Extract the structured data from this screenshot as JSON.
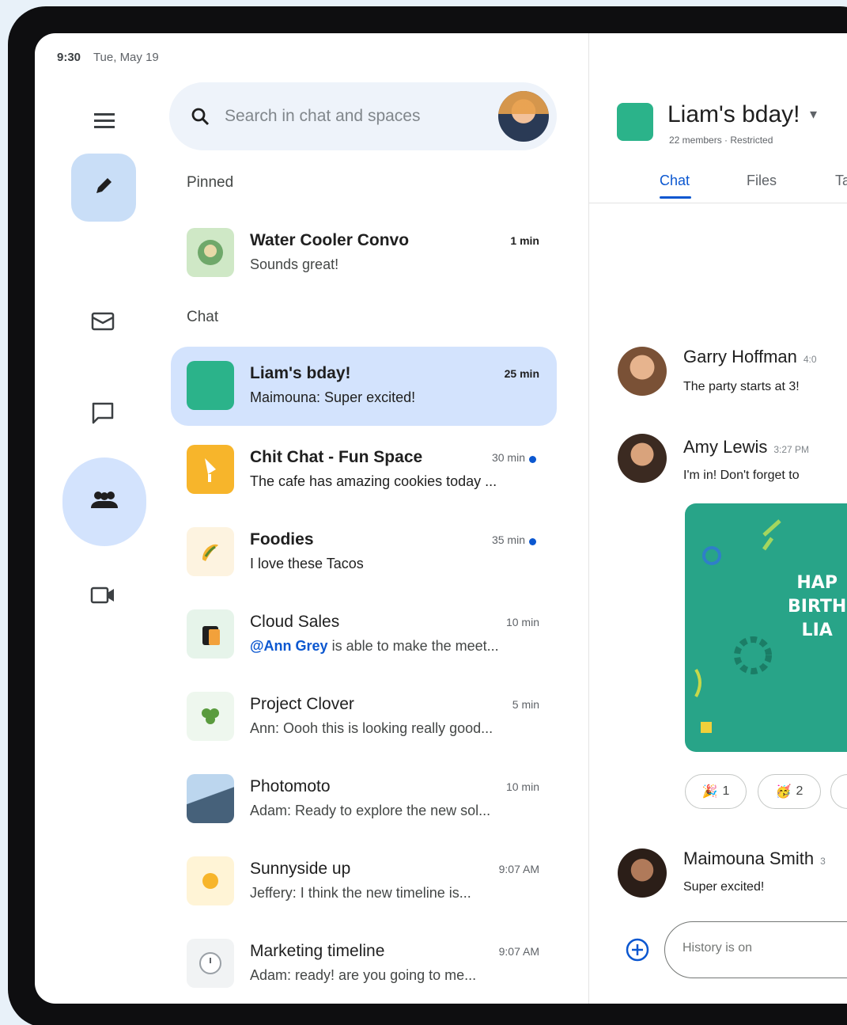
{
  "status_bar": {
    "time": "9:30",
    "date": "Tue, May 19"
  },
  "search": {
    "placeholder": "Search in chat and spaces"
  },
  "sections": {
    "pinned": "Pinned",
    "chat": "Chat"
  },
  "pinned": [
    {
      "title": "Water Cooler Convo",
      "snippet": "Sounds great!",
      "time": "1 min",
      "unread": true,
      "thumb_color": "#cfe8c6"
    }
  ],
  "chats": [
    {
      "title": "Liam's bday!",
      "snippet": "Maimouna: Super excited!",
      "time": "25 min",
      "unread": true,
      "selected": true,
      "thumb_color": "#2bb38a"
    },
    {
      "title": "Chit Chat - Fun Space",
      "snippet": "The cafe has amazing cookies today ...",
      "time": "30 min",
      "unread": true,
      "dot": true,
      "thumb_color": "#f7b52b"
    },
    {
      "title": "Foodies",
      "snippet": "I love these Tacos",
      "time": "35 min",
      "unread": true,
      "dot": true,
      "thumb_color": "#fdf3e0"
    },
    {
      "title": "Cloud Sales",
      "mention": "@Ann Grey",
      "snippet_rest": " is able to make the meet...",
      "time": "10 min",
      "unread": false,
      "thumb_color": "#e6f4ea"
    },
    {
      "title": "Project Clover",
      "snippet": "Ann: Oooh this is looking really good...",
      "time": "5 min",
      "unread": false,
      "thumb_color": "#eef7ee"
    },
    {
      "title": "Photomoto",
      "snippet": "Adam: Ready to explore the new sol...",
      "time": "10 min",
      "unread": false,
      "thumb_color": "#9fc3e7"
    },
    {
      "title": "Sunnyside up",
      "snippet": "Jeffery: I think the new timeline is...",
      "time": "9:07 AM",
      "unread": false,
      "thumb_color": "#fff4d6"
    },
    {
      "title": "Marketing timeline",
      "snippet": "Adam: ready! are you going to me...",
      "time": "9:07 AM",
      "unread": false,
      "thumb_color": "#f1f3f4"
    }
  ],
  "space": {
    "title": "Liam's bday!",
    "meta": "22 members · Restricted",
    "tabs": [
      "Chat",
      "Files",
      "Ta"
    ]
  },
  "messages": [
    {
      "name": "Garry Hoffman",
      "time": "4:0",
      "text": "The party starts at 3!"
    },
    {
      "name": "Amy Lewis",
      "time": "3:27 PM",
      "text": "I'm in! Don't forget to"
    },
    {
      "name": "Maimouna Smith",
      "time": "3",
      "text": "Super excited!"
    }
  ],
  "card": {
    "text": "HAP\nBIRTH\nLIA"
  },
  "reactions": [
    {
      "emoji": "🎉",
      "count": "1"
    },
    {
      "emoji": "🥳",
      "count": "2"
    },
    {
      "emoji": "",
      "count": "("
    }
  ],
  "composer": {
    "placeholder": "History is on"
  },
  "colors": {
    "accent": "#0b57d0",
    "selected_bg": "#d3e3fd",
    "space_green": "#2bb38a"
  }
}
